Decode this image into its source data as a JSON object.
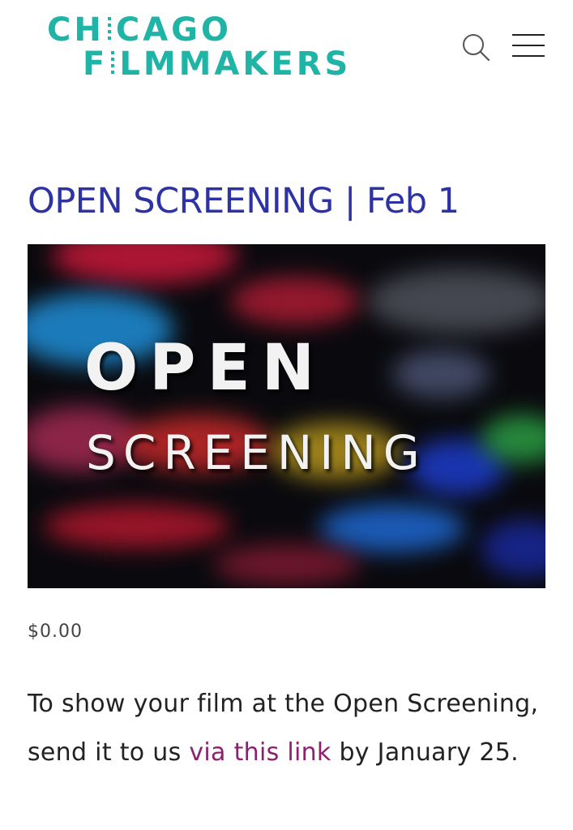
{
  "header": {
    "logo_line1_a": "CH",
    "logo_line1_b": "CAGO",
    "logo_line2_a": "F",
    "logo_line2_b": "LMMAKERS",
    "brand_color": "#1fb4a6",
    "search_icon": "search-icon",
    "menu_icon": "hamburger-menu-icon"
  },
  "event": {
    "title": "OPEN SCREENING | Feb 1",
    "title_color": "#2d33a3",
    "hero_line1": "OPEN",
    "hero_line2": "SCREENING",
    "price": "$0.00",
    "description_before": "To show your film at the Open Screening, send it to us ",
    "description_link": "via this link",
    "description_after": " by January 25.",
    "link_color": "#8e1f6e"
  }
}
